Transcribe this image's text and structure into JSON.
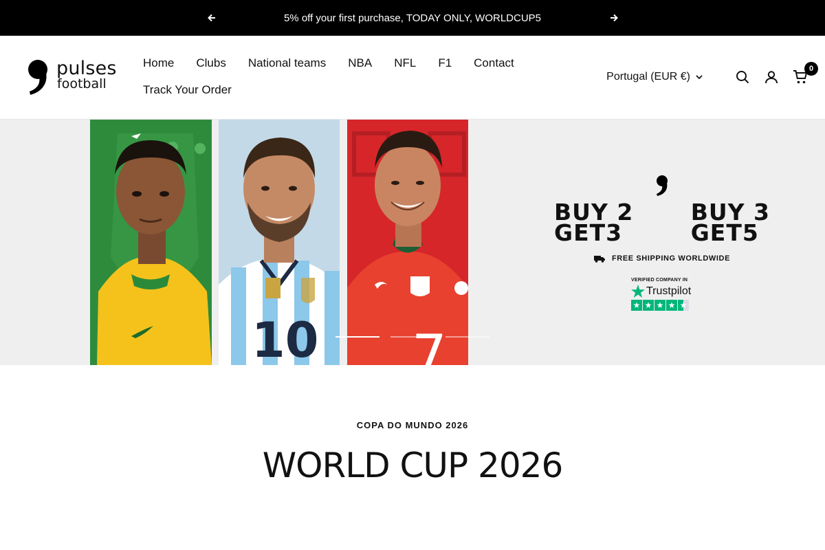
{
  "announcement": {
    "text": "5% off your first purchase, TODAY ONLY, WORLDCUP5",
    "prev_icon": "arrow-left-icon",
    "next_icon": "arrow-right-icon"
  },
  "brand": {
    "line1": "pulses",
    "line2": "football"
  },
  "nav": {
    "row1": [
      "Home",
      "Clubs",
      "National teams",
      "NBA",
      "NFL",
      "F1",
      "Contact"
    ],
    "row2": [
      "Track Your Order"
    ]
  },
  "header_tools": {
    "locale": "Portugal (EUR €)",
    "search_icon": "search-icon",
    "account_icon": "account-icon",
    "cart_icon": "cart-icon",
    "cart_count": "0"
  },
  "hero": {
    "offers": [
      {
        "line1": "BUY 2",
        "line2": "GET3"
      },
      {
        "line1": "BUY 3",
        "line2": "GET5"
      }
    ],
    "shipping": "FREE SHIPPING WORLDWIDE",
    "verified": "VERIFIED COMPANY IN",
    "trustpilot": "Trustpilot",
    "trustpilot_rating": 4.5,
    "jersey_numbers": [
      "10",
      "7"
    ],
    "slides_total": 3,
    "slide_active": 1,
    "colors": {
      "brazil_green": "#2e8b3c",
      "brazil_yellow": "#f4c21b",
      "argentina_blue": "#8cc8ea",
      "portugal_red": "#e0332a",
      "trustpilot_green": "#00b67a"
    }
  },
  "section": {
    "subtitle": "COPA DO MUNDO 2026",
    "title": "WORLD CUP 2026"
  }
}
